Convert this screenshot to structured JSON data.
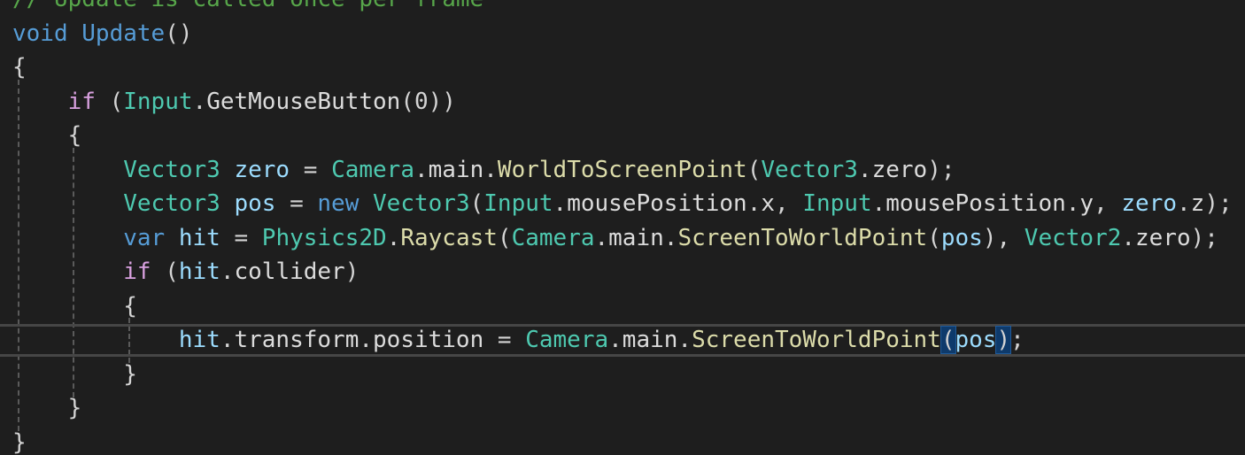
{
  "editor": {
    "language": "C#",
    "colors": {
      "background": "#1e1e1e",
      "comment": "#57a64a",
      "keyword": "#569cd6",
      "control_keyword": "#d8a0df",
      "type": "#4ec9b0",
      "method": "#dcdcaa",
      "variable": "#9cdcfe",
      "punctuation": "#d4d4d4",
      "brace_match_highlight": "#0e3a6b",
      "current_line_border": "#464646"
    },
    "lines": [
      {
        "tokens": [
          {
            "t": "// Update is called once per frame",
            "k": "comment"
          }
        ]
      },
      {
        "tokens": [
          {
            "t": "void",
            "k": "keyword"
          },
          {
            "t": " ",
            "k": "plain"
          },
          {
            "t": "Update",
            "k": "keyword"
          },
          {
            "t": "()",
            "k": "punc"
          }
        ]
      },
      {
        "tokens": [
          {
            "t": "{",
            "k": "punc"
          }
        ]
      },
      {
        "tokens": [
          {
            "t": "    ",
            "k": "plain"
          },
          {
            "t": "if",
            "k": "control"
          },
          {
            "t": " (",
            "k": "punc"
          },
          {
            "t": "Input",
            "k": "type"
          },
          {
            "t": ".",
            "k": "punc"
          },
          {
            "t": "GetMouseButton",
            "k": "plain"
          },
          {
            "t": "(0))",
            "k": "punc"
          }
        ]
      },
      {
        "tokens": [
          {
            "t": "    ",
            "k": "plain"
          },
          {
            "t": "{",
            "k": "punc"
          }
        ]
      },
      {
        "tokens": [
          {
            "t": "        ",
            "k": "plain"
          },
          {
            "t": "Vector3",
            "k": "type"
          },
          {
            "t": " ",
            "k": "plain"
          },
          {
            "t": "zero",
            "k": "var"
          },
          {
            "t": " = ",
            "k": "punc"
          },
          {
            "t": "Camera",
            "k": "type"
          },
          {
            "t": ".",
            "k": "punc"
          },
          {
            "t": "main",
            "k": "plain"
          },
          {
            "t": ".",
            "k": "punc"
          },
          {
            "t": "WorldToScreenPoint",
            "k": "method"
          },
          {
            "t": "(",
            "k": "punc"
          },
          {
            "t": "Vector3",
            "k": "type"
          },
          {
            "t": ".",
            "k": "punc"
          },
          {
            "t": "zero",
            "k": "plain"
          },
          {
            "t": ");",
            "k": "punc"
          }
        ]
      },
      {
        "tokens": [
          {
            "t": "        ",
            "k": "plain"
          },
          {
            "t": "Vector3",
            "k": "type"
          },
          {
            "t": " ",
            "k": "plain"
          },
          {
            "t": "pos",
            "k": "var"
          },
          {
            "t": " = ",
            "k": "punc"
          },
          {
            "t": "new",
            "k": "keyword"
          },
          {
            "t": " ",
            "k": "plain"
          },
          {
            "t": "Vector3",
            "k": "type"
          },
          {
            "t": "(",
            "k": "punc"
          },
          {
            "t": "Input",
            "k": "type"
          },
          {
            "t": ".",
            "k": "punc"
          },
          {
            "t": "mousePosition",
            "k": "plain"
          },
          {
            "t": ".",
            "k": "punc"
          },
          {
            "t": "x",
            "k": "plain"
          },
          {
            "t": ", ",
            "k": "punc"
          },
          {
            "t": "Input",
            "k": "type"
          },
          {
            "t": ".",
            "k": "punc"
          },
          {
            "t": "mousePosition",
            "k": "plain"
          },
          {
            "t": ".",
            "k": "punc"
          },
          {
            "t": "y",
            "k": "plain"
          },
          {
            "t": ", ",
            "k": "punc"
          },
          {
            "t": "zero",
            "k": "var"
          },
          {
            "t": ".",
            "k": "punc"
          },
          {
            "t": "z",
            "k": "plain"
          },
          {
            "t": ");",
            "k": "punc"
          }
        ]
      },
      {
        "tokens": [
          {
            "t": "        ",
            "k": "plain"
          },
          {
            "t": "var",
            "k": "keyword"
          },
          {
            "t": " ",
            "k": "plain"
          },
          {
            "t": "hit",
            "k": "var"
          },
          {
            "t": " = ",
            "k": "punc"
          },
          {
            "t": "Physics2D",
            "k": "type"
          },
          {
            "t": ".",
            "k": "punc"
          },
          {
            "t": "Raycast",
            "k": "method"
          },
          {
            "t": "(",
            "k": "punc"
          },
          {
            "t": "Camera",
            "k": "type"
          },
          {
            "t": ".",
            "k": "punc"
          },
          {
            "t": "main",
            "k": "plain"
          },
          {
            "t": ".",
            "k": "punc"
          },
          {
            "t": "ScreenToWorldPoint",
            "k": "method"
          },
          {
            "t": "(",
            "k": "punc"
          },
          {
            "t": "pos",
            "k": "var"
          },
          {
            "t": "), ",
            "k": "punc"
          },
          {
            "t": "Vector2",
            "k": "type"
          },
          {
            "t": ".",
            "k": "punc"
          },
          {
            "t": "zero",
            "k": "plain"
          },
          {
            "t": ");",
            "k": "punc"
          }
        ]
      },
      {
        "tokens": [
          {
            "t": "        ",
            "k": "plain"
          },
          {
            "t": "if",
            "k": "control"
          },
          {
            "t": " (",
            "k": "punc"
          },
          {
            "t": "hit",
            "k": "var"
          },
          {
            "t": ".",
            "k": "punc"
          },
          {
            "t": "collider",
            "k": "plain"
          },
          {
            "t": ")",
            "k": "punc"
          }
        ]
      },
      {
        "tokens": [
          {
            "t": "        ",
            "k": "plain"
          },
          {
            "t": "{",
            "k": "punc"
          }
        ]
      },
      {
        "current": true,
        "tokens": [
          {
            "t": "            ",
            "k": "plain"
          },
          {
            "t": "hit",
            "k": "var"
          },
          {
            "t": ".",
            "k": "punc"
          },
          {
            "t": "transform",
            "k": "plain"
          },
          {
            "t": ".",
            "k": "punc"
          },
          {
            "t": "position",
            "k": "plain"
          },
          {
            "t": " = ",
            "k": "punc"
          },
          {
            "t": "Camera",
            "k": "type"
          },
          {
            "t": ".",
            "k": "punc"
          },
          {
            "t": "main",
            "k": "plain"
          },
          {
            "t": ".",
            "k": "punc"
          },
          {
            "t": "ScreenToWorldPoint",
            "k": "method"
          },
          {
            "t": "(",
            "k": "punc",
            "hl": true
          },
          {
            "t": "pos",
            "k": "var"
          },
          {
            "t": ")",
            "k": "punc",
            "hl": true
          },
          {
            "t": ";",
            "k": "punc"
          }
        ]
      },
      {
        "tokens": [
          {
            "t": "        ",
            "k": "plain"
          },
          {
            "t": "}",
            "k": "punc"
          }
        ]
      },
      {
        "tokens": [
          {
            "t": "    ",
            "k": "plain"
          },
          {
            "t": "}",
            "k": "punc"
          }
        ]
      },
      {
        "tokens": [
          {
            "t": "}",
            "k": "punc"
          }
        ]
      }
    ]
  }
}
